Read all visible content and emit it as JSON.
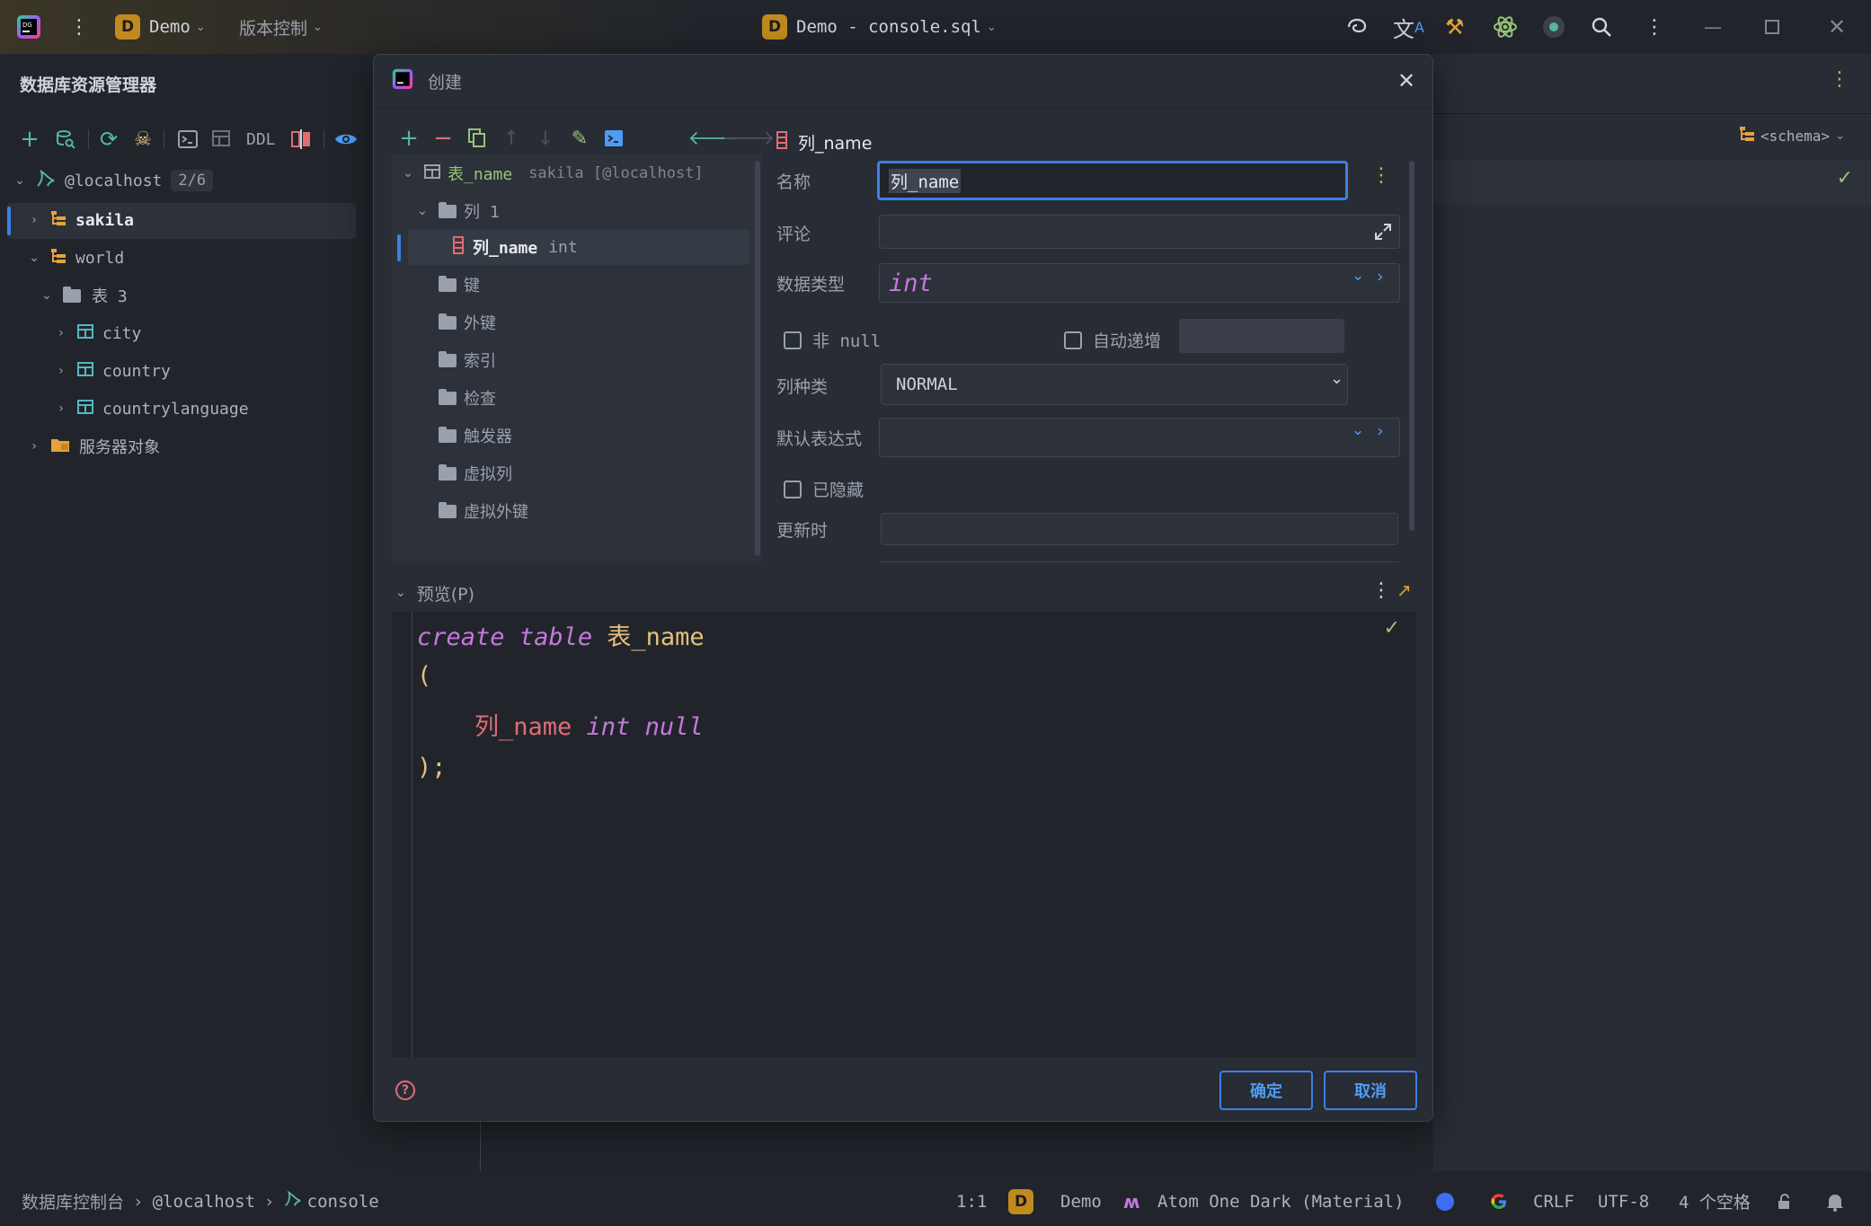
{
  "titlebar": {
    "project_badge": "D",
    "project_name": "Demo",
    "vcs_label": "版本控制",
    "file_badge": "D",
    "file_title": "Demo - console.sql",
    "icons": [
      "ai-swirl-icon",
      "translate-icon",
      "build-tools-icon",
      "atom-icon",
      "record-icon",
      "search-icon",
      "more-vert-icon",
      "minimize-icon",
      "maximize-icon",
      "close-icon"
    ]
  },
  "left_panel": {
    "title": "数据库资源管理器",
    "toolbar": {
      "ddl_label": "DDL"
    },
    "tree": {
      "host_label": "@localhost",
      "host_count": "2/6",
      "schema1": "sakila",
      "schema2": "world",
      "tables_label": "表 3",
      "tables": [
        "city",
        "country",
        "countrylanguage"
      ],
      "server_objects": "服务器对象"
    }
  },
  "right_bg": {
    "schema_selector": "<schema>"
  },
  "dialog": {
    "title": "创建",
    "tree": {
      "table_name": "表_name",
      "table_context": "sakila [@localhost]",
      "columns_label": "列 1",
      "column_name": "列_name",
      "column_type": "int",
      "folders": [
        "键",
        "外键",
        "索引",
        "检查",
        "触发器",
        "虚拟列",
        "虚拟外键"
      ]
    },
    "form": {
      "header_name": "列_name",
      "name_label": "名称",
      "name_value": "列_name",
      "comment_label": "评论",
      "comment_value": "",
      "datatype_label": "数据类型",
      "datatype_value": "int",
      "not_null_label": "非 null",
      "auto_inc_label": "自动递增",
      "kind_label": "列种类",
      "kind_value": "NORMAL",
      "default_label": "默认表达式",
      "default_value": "",
      "hidden_label": "已隐藏",
      "on_update_label": "更新时",
      "on_update_value": ""
    },
    "preview": {
      "label": "预览(P)",
      "line1_kw1": "create",
      "line1_kw2": "table",
      "line1_ident": "表_name",
      "line2": "(",
      "line3_col": "列_name",
      "line3_type": "int",
      "line3_null": "null",
      "line4": ");"
    },
    "buttons": {
      "ok": "确定",
      "cancel": "取消"
    }
  },
  "statusbar": {
    "crumb1": "数据库控制台",
    "crumb2": "@localhost",
    "crumb3": "console",
    "position": "1:1",
    "badge": "D",
    "project": "Demo",
    "theme": "Atom One Dark (Material)",
    "line_ending": "CRLF",
    "encoding": "UTF-8",
    "indent": "4 个空格"
  },
  "colors": {
    "accent": "#3d7fe6",
    "folder_orange": "#e5a23a",
    "table_teal": "#56b6c2",
    "keyword": "#c678dd",
    "identifier": "#e5c07b",
    "column": "#e06c75"
  }
}
